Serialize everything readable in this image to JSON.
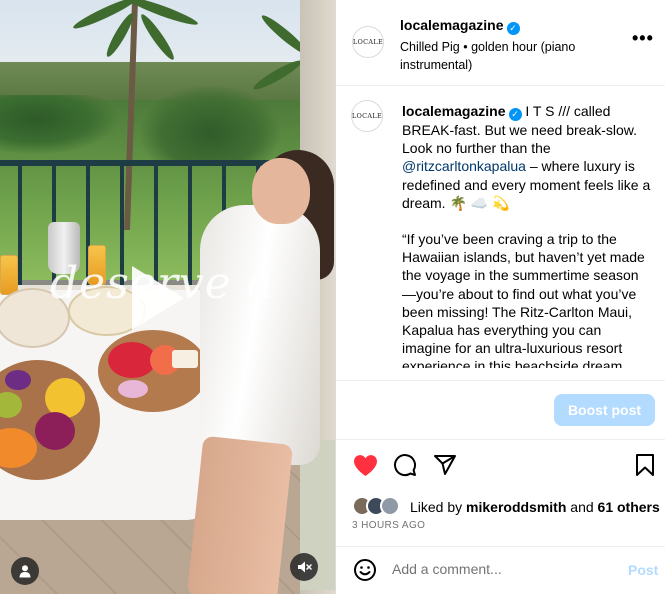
{
  "media": {
    "overlay_text": "deserve a",
    "play_icon": "play-icon",
    "user_tag_icon": "person-icon",
    "mute_icon": "speaker-muted-icon"
  },
  "post_header": {
    "username": "localemagazine",
    "avatar_text": "LOCALE",
    "audio": "Chilled Pig • golden hour (piano instrumental)",
    "more_icon": "•••"
  },
  "caption": {
    "username": "localemagazine",
    "avatar_text": "LOCALE",
    "p1_a": " I T S /// called BREAK-fast. But we need break-slow. Look no further than the ",
    "mention": "@ritzcarltonkapalua",
    "p1_b": " – where luxury is redefined and every moment feels like a dream. ",
    "emoji": "🌴 ☁️ 💫",
    "p2": "“If you’ve been craving a trip to the Hawaiian islands, but haven’t yet made the voyage in the summertime season—you’re about to find out what you’ve been missing! The Ritz-Carlton Maui, Kapalua has everything you can imagine for an ultra-luxurious resort experience in this beachside dream"
  },
  "boost_label": "Boost post",
  "likes": {
    "prefix": "Liked by ",
    "user": "mikeroddsmith",
    "middle": " and ",
    "others": "61 others"
  },
  "timestamp": "3 HOURS AGO",
  "comment": {
    "placeholder": "Add a comment...",
    "post_label": "Post"
  },
  "colors": {
    "accent": "#0095f6",
    "like_red": "#ff3040",
    "boost_bg": "#b3dbff",
    "mention": "#00376b",
    "muted_text": "#737373"
  }
}
